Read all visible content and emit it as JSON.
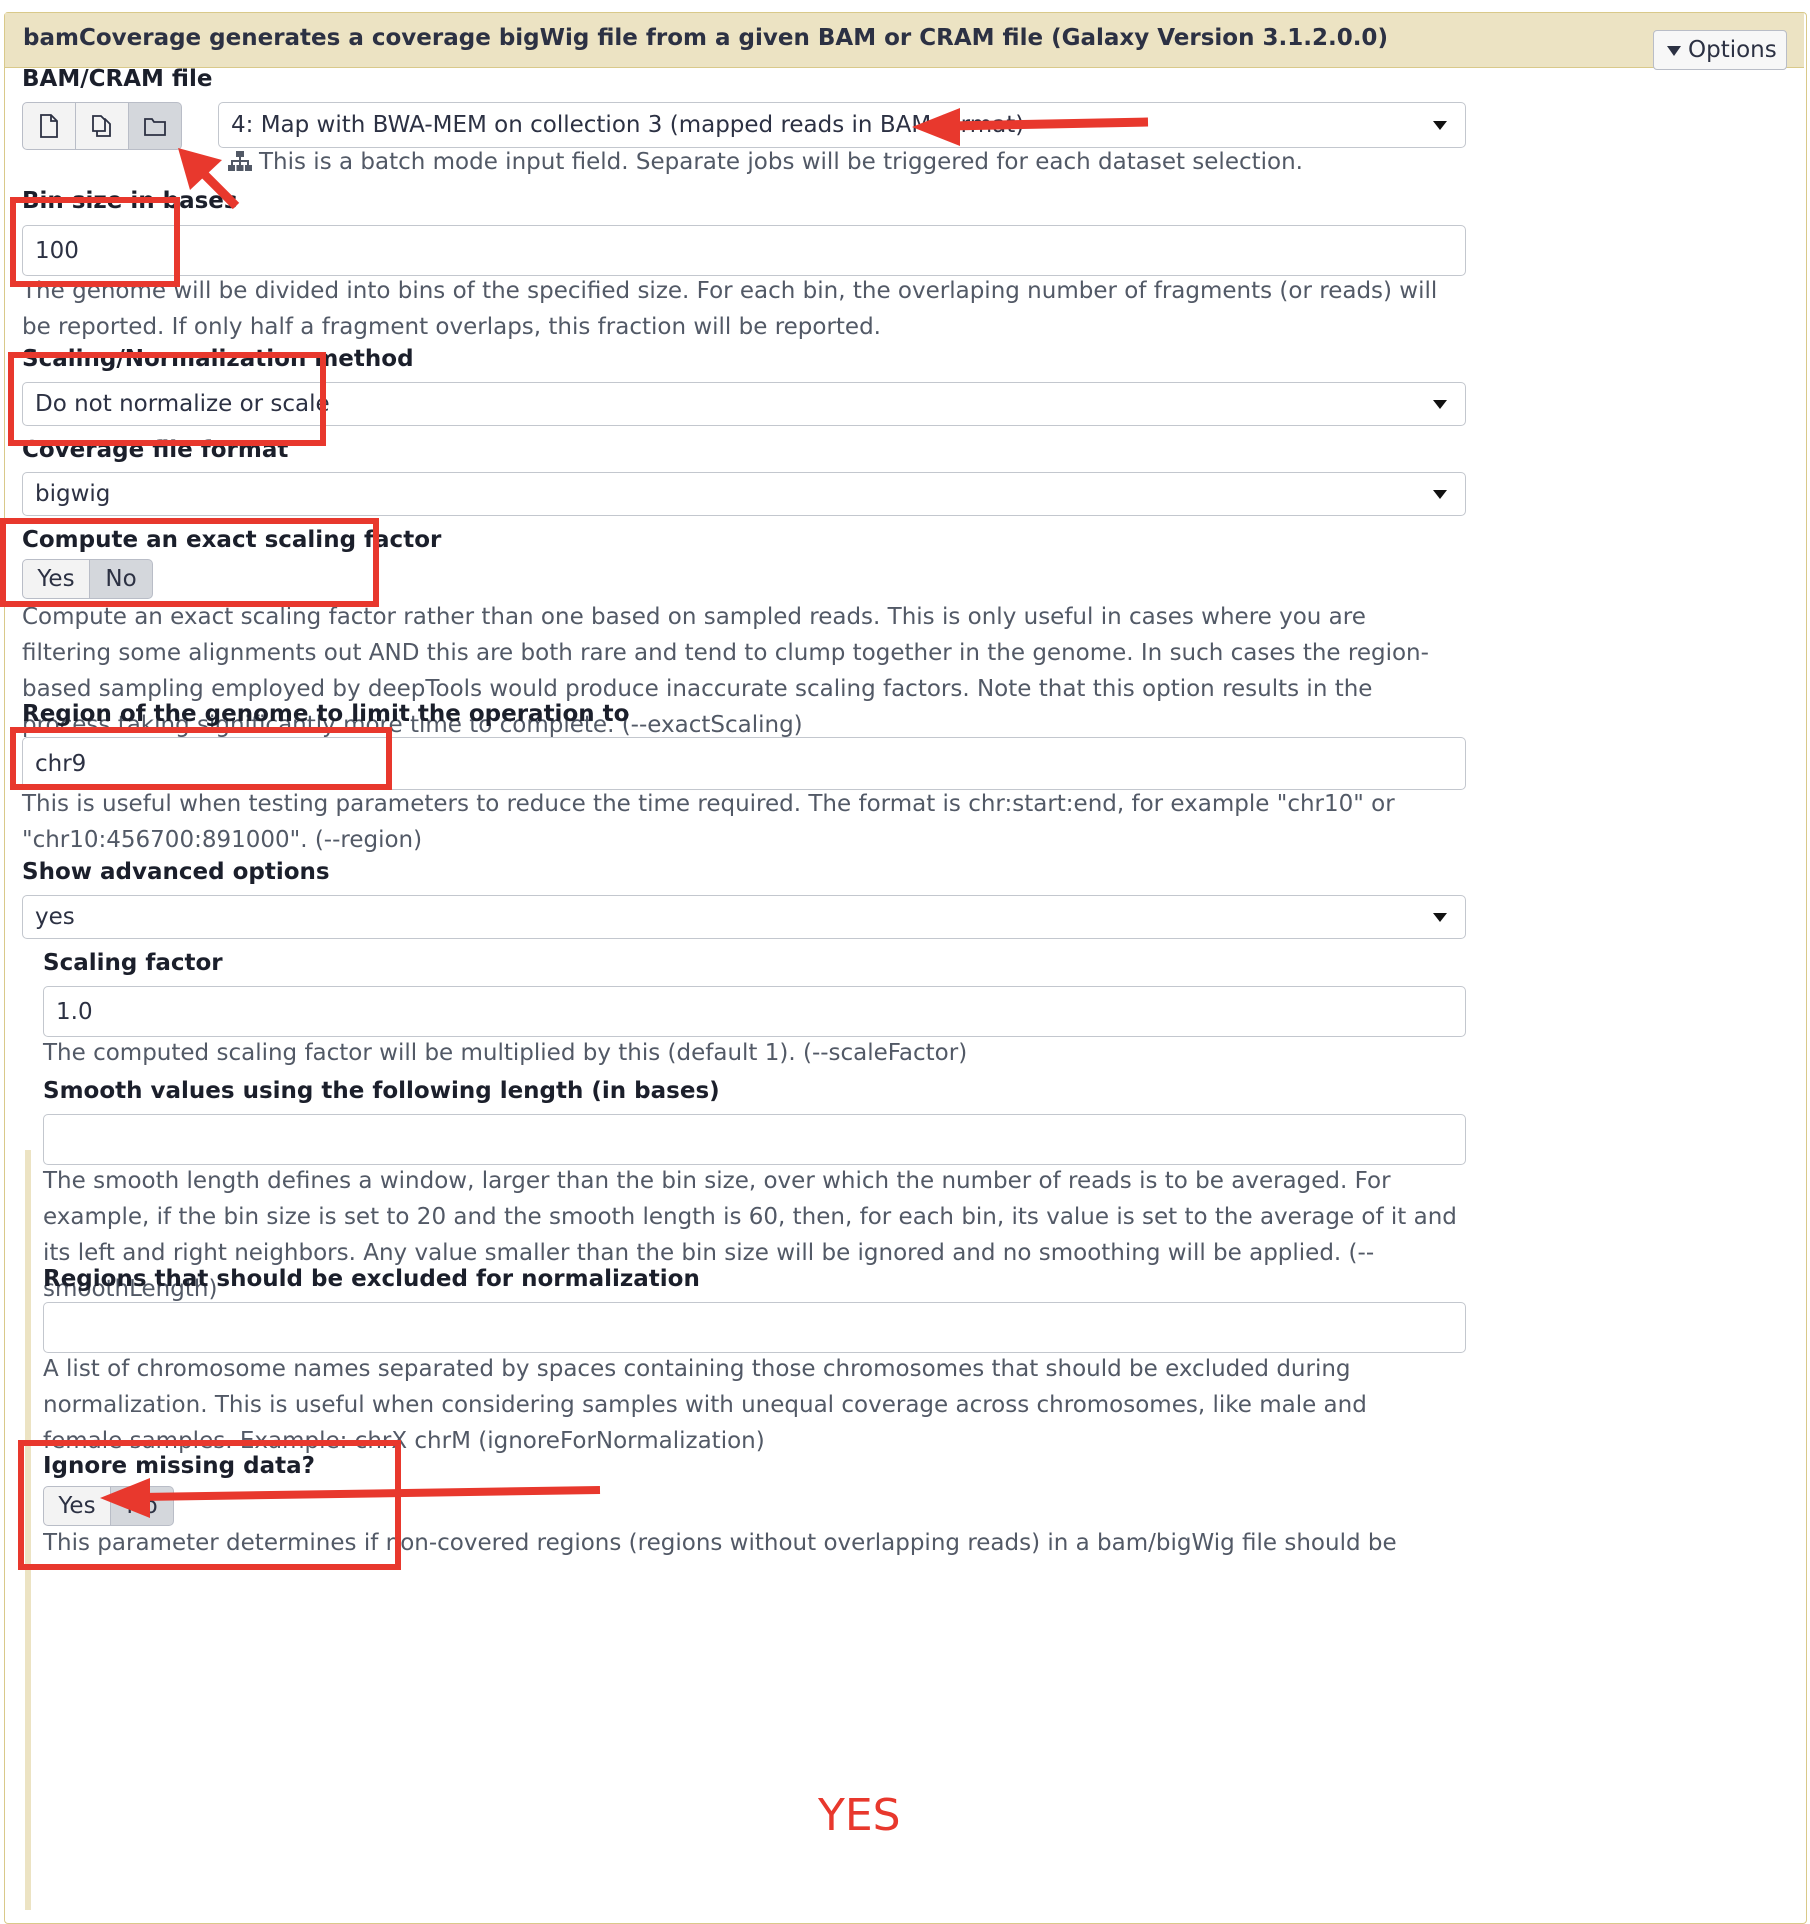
{
  "header": {
    "title": "bamCoverage generates a coverage bigWig file from a given BAM or CRAM file (Galaxy Version 3.1.2.0.0)",
    "options_label": "Options"
  },
  "bam_input": {
    "label": "BAM/CRAM file",
    "selected": "4: Map with BWA-MEM on collection 3 (mapped reads in BAM format)",
    "batch_help": "This is a batch mode input field. Separate jobs will be triggered for each dataset selection."
  },
  "bin_size": {
    "label": "Bin size in bases",
    "value": "100",
    "help": "The genome will be divided into bins of the specified size. For each bin, the overlaping number of fragments (or reads) will be reported. If only half a fragment overlaps, this fraction will be reported."
  },
  "normalization": {
    "label": "Scaling/Normalization method",
    "selected": "Do not normalize or scale"
  },
  "coverage_format": {
    "label": "Coverage file format",
    "selected": "bigwig"
  },
  "exact_scaling": {
    "label": "Compute an exact scaling factor",
    "yes": "Yes",
    "no": "No",
    "help": "Compute an exact scaling factor rather than one based on sampled reads. This is only useful in cases where you are filtering some alignments out AND this are both rare and tend to clump together in the genome. In such cases the region-based sampling employed by deepTools would produce inaccurate scaling factors. Note that this option results in the process taking significantly more time to complete. (--exactScaling)"
  },
  "region": {
    "label": "Region of the genome to limit the operation to",
    "value": "chr9",
    "help": "This is useful when testing parameters to reduce the time required. The format is chr:start:end, for example \"chr10\" or \"chr10:456700:891000\". (--region)"
  },
  "advanced": {
    "label": "Show advanced options",
    "selected": "yes"
  },
  "scaling_factor": {
    "label": "Scaling factor",
    "value": "1.0",
    "help": "The computed scaling factor will be multiplied by this (default 1). (--scaleFactor)"
  },
  "smooth": {
    "label": "Smooth values using the following length (in bases)",
    "value": "",
    "help": "The smooth length defines a window, larger than the bin size, over which the number of reads is to be averaged. For example, if the bin size is set to 20 and the smooth length is 60, then, for each bin, its value is set to the average of it and its left and right neighbors. Any value smaller than the bin size will be ignored and no smoothing will be applied. (--smoothLength)"
  },
  "exclude": {
    "label": "Regions that should be excluded for normalization",
    "value": "",
    "help": "A list of chromosome names separated by spaces containing those chromosomes that should be excluded during normalization. This is useful when considering samples with unequal coverage across chromosomes, like male and female samples. Example: chrX chrM (ignoreForNormalization)"
  },
  "ignore_missing": {
    "label": "Ignore missing data?",
    "yes": "Yes",
    "no": "No",
    "help": "This parameter determines if non-covered regions (regions without overlapping reads) in a bam/bigWig file should be skipped. The default is to treat those regions as having a value of zero. The decision to skip non-covered regions depends on the interpretation of the data. Non-covered regions"
  },
  "annotation": {
    "yes_text": "YES",
    "color": "#e8382d"
  }
}
